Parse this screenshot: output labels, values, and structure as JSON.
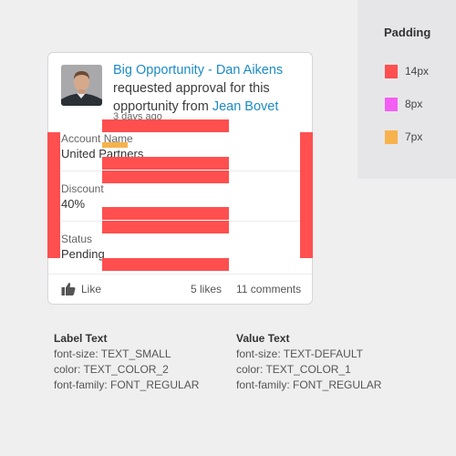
{
  "legend": {
    "title": "Padding",
    "items": [
      {
        "color": "#ff4f4f",
        "label": "14px"
      },
      {
        "color": "#f35ff2",
        "label": "8px"
      },
      {
        "color": "#f7b24c",
        "label": "7px"
      }
    ]
  },
  "card": {
    "title_link": "Big Opportunity - Dan Aikens",
    "message": " requested approval for this opportunity from ",
    "person_link": "Jean Bovet",
    "timestamp": "3 days ago",
    "fields": [
      {
        "label": "Account Name",
        "value": "United Partners"
      },
      {
        "label": "Discount",
        "value": "40%"
      },
      {
        "label": "Status",
        "value": "Pending"
      }
    ],
    "footer": {
      "like_label": "Like",
      "likes": "5 likes",
      "comments": "11 comments"
    }
  },
  "specs": {
    "label": {
      "title": "Label Text",
      "font_size": "font-size: TEXT_SMALL",
      "color": "color: TEXT_COLOR_2",
      "font_family": "font-family: FONT_REGULAR"
    },
    "value": {
      "title": "Value Text",
      "font_size": "font-size: TEXT-DEFAULT",
      "color": "color: TEXT_COLOR_1",
      "font_family": "font-family: FONT_REGULAR"
    }
  },
  "colors": {
    "link": "#1c8bc4",
    "padding_14": "#ff4f4f",
    "padding_8": "#f35ff2",
    "padding_7": "#f7b24c"
  }
}
